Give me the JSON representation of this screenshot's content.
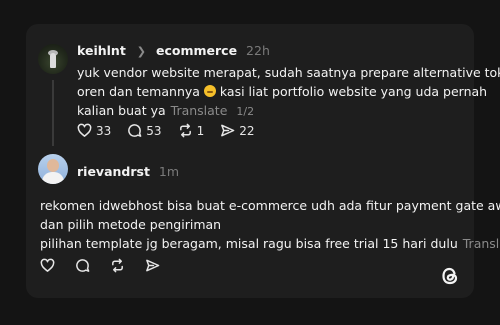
{
  "post": {
    "username": "keihlnt",
    "community": "ecommerce",
    "time": "22h",
    "line1": "yuk vendor website merapat, sudah saatnya prepare alternative toko",
    "line2_before": "oren dan temannya",
    "line2_after": "kasi liat portfolio website yang uda pernah",
    "line3": "kalian buat ya",
    "translate": "Translate",
    "pager": "1/2",
    "likes": "33",
    "comments": "53",
    "reposts": "1",
    "shares": "22"
  },
  "reply": {
    "username": "rievandrst",
    "time": "1m",
    "line1": "rekomen idwebhost bisa buat e-commerce udh ada fitur payment gate away",
    "line2": "dan pilih metode pengiriman",
    "line3": "pilihan template jg beragam, misal ragu bisa free trial 15 hari dulu",
    "translate": "Translate"
  },
  "icons": {
    "like": "heart-icon",
    "comment": "comment-icon",
    "repost": "repost-icon",
    "share": "share-icon",
    "logo": "threads-logo-icon",
    "emoji": "smirk-emoji-icon"
  }
}
